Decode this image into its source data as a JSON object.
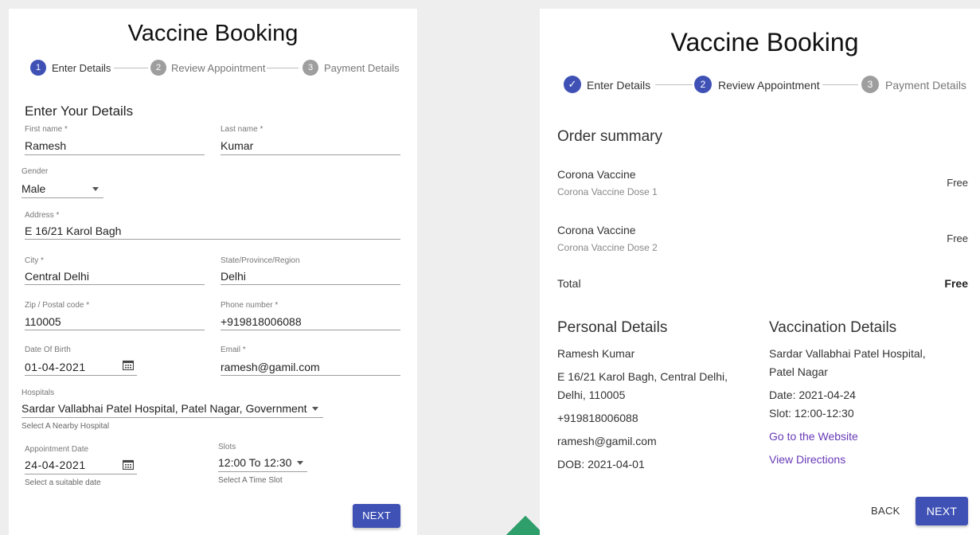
{
  "left_form": {
    "title": "Vaccine Booking",
    "steps": [
      {
        "number": "1",
        "label": "Enter Details",
        "state": "active"
      },
      {
        "number": "2",
        "label": "Review Appointment",
        "state": "inactive"
      },
      {
        "number": "3",
        "label": "Payment Details",
        "state": "inactive"
      }
    ],
    "section_title": "Enter Your Details",
    "first_name": {
      "label": "First name *",
      "value": "Ramesh"
    },
    "last_name": {
      "label": "Last name *",
      "value": "Kumar"
    },
    "gender": {
      "label": "Gender",
      "value": "Male"
    },
    "address": {
      "label": "Address *",
      "value": "E 16/21 Karol Bagh"
    },
    "city": {
      "label": "City *",
      "value": "Central Delhi"
    },
    "state": {
      "label": "State/Province/Region",
      "value": "Delhi"
    },
    "zip": {
      "label": "Zip / Postal code *",
      "value": "110005"
    },
    "phone": {
      "label": "Phone number *",
      "value": "+919818006088"
    },
    "dob": {
      "label": "Date Of Birth",
      "value": "01-04-2021"
    },
    "email": {
      "label": "Email *",
      "value": "ramesh@gamil.com"
    },
    "hospitals": {
      "label": "Hospitals",
      "value": "Sardar Vallabhai Patel Hospital, Patel Nagar, Government",
      "helper": "Select A Nearby Hospital"
    },
    "appointment_date": {
      "label": "Appointment Date",
      "value": "24-04-2021",
      "helper": "Select a suitable date"
    },
    "slots": {
      "label": "Slots",
      "value": "12:00 To 12:30",
      "helper": "Select A Time Slot"
    },
    "next_label": "NEXT"
  },
  "right_review": {
    "title": "Vaccine Booking",
    "steps": [
      {
        "number": "✓",
        "label": "Enter Details",
        "state": "completed"
      },
      {
        "number": "2",
        "label": "Review Appointment",
        "state": "active"
      },
      {
        "number": "3",
        "label": "Payment Details",
        "state": "inactive"
      }
    ],
    "order_summary_title": "Order summary",
    "items": [
      {
        "name": "Corona Vaccine",
        "desc": "Corona Vaccine Dose 1",
        "price": "Free"
      },
      {
        "name": "Corona Vaccine",
        "desc": "Corona Vaccine Dose 2",
        "price": "Free"
      }
    ],
    "total_label": "Total",
    "total_value": "Free",
    "personal_title": "Personal Details",
    "personal": {
      "name": "Ramesh Kumar",
      "address_line1": "E 16/21 Karol Bagh, Central Delhi,",
      "address_line2": "Delhi, 110005",
      "phone": "+919818006088",
      "email": "ramesh@gamil.com",
      "dob": "DOB: 2021-04-01"
    },
    "vaccination_title": "Vaccination Details",
    "vaccination": {
      "hospital_line1": "Sardar Vallabhai Patel Hospital,",
      "hospital_line2": "Patel Nagar",
      "date": "Date: 2021-04-24",
      "slot": "Slot: 12:00-12:30",
      "website_link": "Go to the Website",
      "directions_link": "View Directions"
    },
    "back_label": "BACK",
    "next_label": "NEXT"
  },
  "colors": {
    "primary": "#3f51b5",
    "link": "#673ab7",
    "inactive_step": "#9e9e9e",
    "background": "#eeeeee",
    "decor": "#2e9e6b"
  }
}
